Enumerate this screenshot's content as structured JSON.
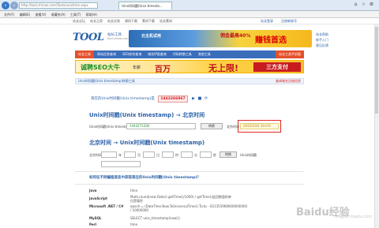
{
  "browser": {
    "url": "http://tool.chinaz.com/Tools/unixtime.aspx",
    "tab_title": "Unix时间戳(Unix timesta...",
    "menu": [
      "文件(F)",
      "编辑(E)",
      "查看(V)",
      "收藏夹(A)",
      "工具(T)",
      "帮助(H)"
    ],
    "right_icons": [
      "⌂",
      "☆",
      "⚙"
    ]
  },
  "site_top": {
    "left_links": [
      "站长论坛",
      "站长之家",
      "站长交易",
      "源码下载",
      "素材下载",
      "站长素材"
    ],
    "right_links": [
      "站长登录",
      "注册新账号"
    ]
  },
  "header": {
    "logo": "TOOL",
    "logo_sub": "站长工具",
    "logo_url": "tool.chinaz.com",
    "ad_text_left": "云主机试用",
    "ad_text_mid": "佣金最高40%",
    "ad_text_right": "赚钱首选",
    "links": [
      "站长帮助",
      "新手入门",
      "意见反馈",
      "工具导航"
    ]
  },
  "nav": {
    "items": [
      "站长工具",
      "网站信息查询",
      "SEO综合查询",
      "域名IP类查询",
      "代码转换工具",
      "其他工具",
      "站长工具手机版"
    ],
    "active_index": 0
  },
  "banner": {
    "left": "诚聘SEO大牛",
    "mid": "年薪",
    "highlight": "百万",
    "tail": "无上限!",
    "right": "三方支付"
  },
  "breadcrumb": {
    "text": "Unix时间戳(Unix timestamp)转换工具",
    "right": "查询域名注册信息"
  },
  "current": {
    "label": "现在的Unix时间戳(Unix timestamp)是",
    "value": "1443266867",
    "controls": [
      "▶",
      "■",
      "⟳"
    ]
  },
  "section1": {
    "title": "Unix时间戳(Unix timestamp) → 北京时间",
    "input_label": "Unix时间戳(Unix timestamp)",
    "input_value": "1443271200",
    "button": "转换",
    "result_label": "北京时间",
    "result_value": "2015/10/2 10:0:0"
  },
  "section2": {
    "title": "北京时间 → Unix时间戳(Unix timestamp)",
    "label": "北京时间",
    "units": [
      "年",
      "月",
      "日",
      "时",
      "分",
      "秒"
    ],
    "button": "转换",
    "result_label": "Unix时间戳"
  },
  "section3": {
    "title": "如何在不同编程语言中获取现在的Unix时间戳(Unix timestamp)？",
    "rows": [
      {
        "lang": "Java",
        "code": "time"
      },
      {
        "lang": "JavaScript",
        "code": "Math.round(new Date().getTime()/1000) / getTime()返回数值的单位是毫秒"
      },
      {
        "lang": "Microsoft .NET / C#",
        "code": "epoch = (DateTime.Now.ToUniversalTime().Ticks - 621355968000000000) / 10000000"
      },
      {
        "lang": "MySQL",
        "code": "SELECT unix_timestamp(now())"
      },
      {
        "lang": "Perl",
        "code": "time"
      }
    ]
  },
  "watermark": {
    "main": "Baidu经验",
    "sub": "jingyan.baidu.com"
  }
}
